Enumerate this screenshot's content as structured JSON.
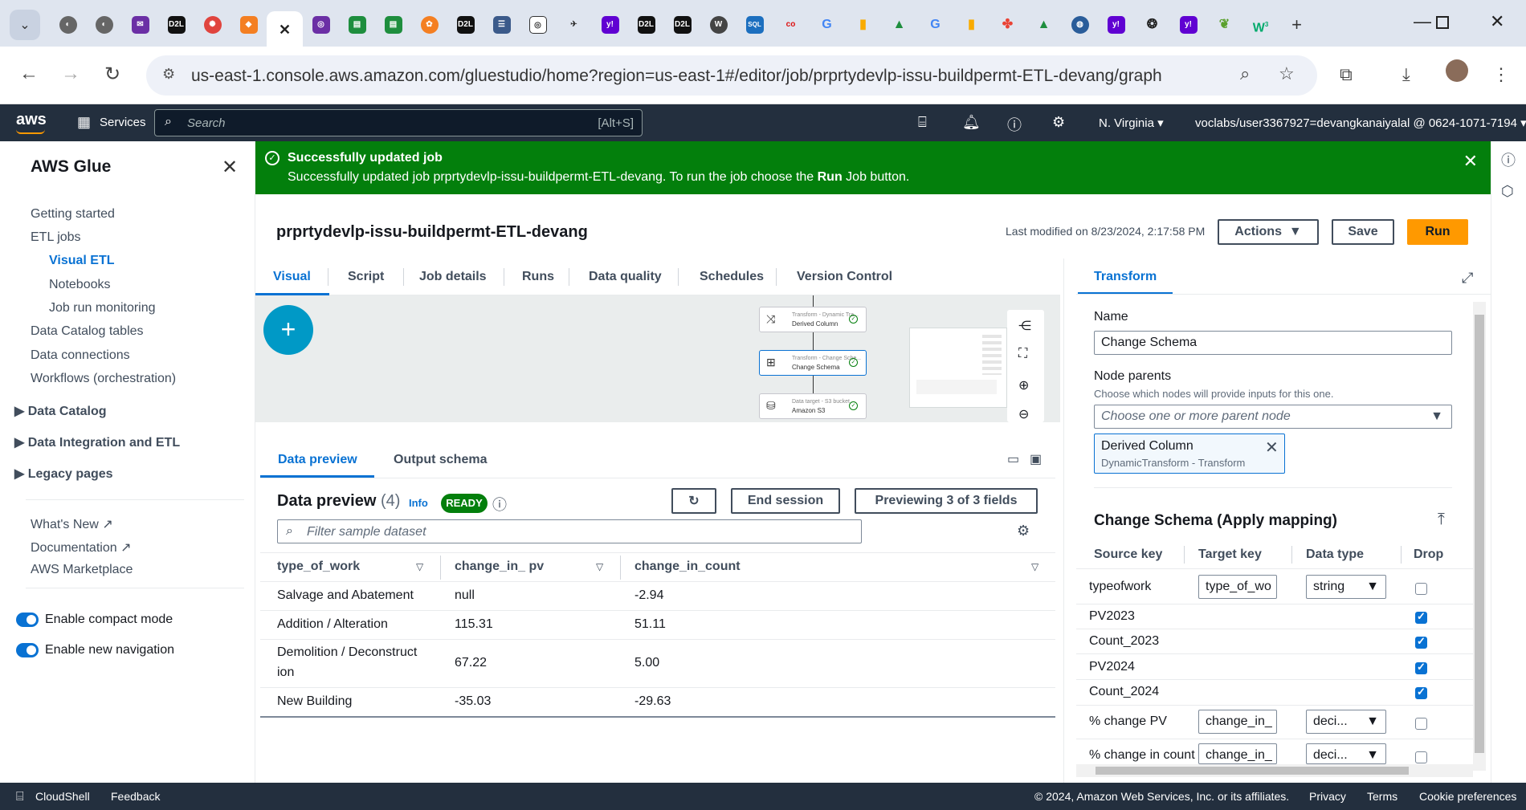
{
  "browser": {
    "url": "us-east-1.console.aws.amazon.com/gluestudio/home?region=us-east-1#/editor/job/prprtydevlp-issu-buildpermt-ETL-devang/graph",
    "tab_favicons": [
      "globe-icon",
      "globe-icon",
      "mail-icon",
      "d2l-icon",
      "wheel-icon",
      "cube-icon",
      "close-tab-icon",
      "search-tab-icon",
      "sheet-icon",
      "sheet-icon",
      "orange-icon",
      "d2l-icon",
      "doc-icon",
      "spiral-icon",
      "bird-icon",
      "yahoo-icon",
      "d2l-icon",
      "d2l-icon",
      "wordpress-icon",
      "sql-icon",
      "co-icon",
      "google-icon",
      "analytics-icon",
      "drive-icon",
      "google-icon",
      "analytics-icon",
      "pinwheel-icon",
      "drive-icon",
      "globe-icon",
      "yahoo-icon",
      "openai-icon",
      "yahoo-icon",
      "leaf-icon",
      "w3-icon"
    ],
    "d2l_text": "D2L",
    "sql_text": "SQL",
    "co_text": "co",
    "g_text": "G",
    "y_text": "y!",
    "w_text": "W",
    "w3_text": "3"
  },
  "awsnav": {
    "services": "Services",
    "search_placeholder": "Search",
    "search_shortcut": "[Alt+S]",
    "region": "N. Virginia",
    "account": "voclabs/user3367927=devangkanaiyalal @ 0624-1071-7194"
  },
  "sidebar": {
    "title": "AWS Glue",
    "getting_started": "Getting started",
    "etl_jobs": "ETL jobs",
    "visual_etl": "Visual ETL",
    "notebooks": "Notebooks",
    "job_run_monitoring": "Job run monitoring",
    "data_catalog_tables": "Data Catalog tables",
    "data_connections": "Data connections",
    "workflows": "Workflows (orchestration)",
    "sec_data_catalog": "Data Catalog",
    "sec_data_integration": "Data Integration and ETL",
    "sec_legacy": "Legacy pages",
    "whats_new": "What's New",
    "documentation": "Documentation",
    "marketplace": "AWS Marketplace",
    "compact_mode": "Enable compact mode",
    "new_navigation": "Enable new navigation"
  },
  "flash": {
    "title": "Successfully updated job",
    "message_pre": "Successfully updated job prprtydevlp-issu-buildpermt-ETL-devang. To run the job choose the ",
    "message_bold": "Run",
    "message_post": " Job button."
  },
  "job": {
    "name": "prprtydevlp-issu-buildpermt-ETL-devang",
    "last_modified": "Last modified on 8/23/2024, 2:17:58 PM",
    "actions": "Actions",
    "save": "Save",
    "run": "Run"
  },
  "tabs": [
    "Visual",
    "Script",
    "Job details",
    "Runs",
    "Data quality",
    "Schedules",
    "Version Control"
  ],
  "canvas": {
    "node1_type": "Transform - Dynamic Tra...",
    "node1_name": "Derived Column",
    "node2_type": "Transform - Change Sche...",
    "node2_name": "Change Schema",
    "node3_type": "Data target - S3 bucket",
    "node3_name": "Amazon S3",
    "add": "+"
  },
  "preview": {
    "tab_data_preview": "Data preview",
    "tab_output_schema": "Output schema",
    "title": "Data preview",
    "count": "(4)",
    "info": "Info",
    "status": "READY",
    "end_session": "End session",
    "previewing": "Previewing 3 of 3 fields",
    "filter_placeholder": "Filter sample dataset",
    "columns": [
      "type_of_work",
      "change_in_ pv",
      "change_in_count"
    ],
    "rows": [
      [
        "Salvage and Abatement",
        "null",
        "-2.94"
      ],
      [
        "Addition / Alteration",
        "115.31",
        "51.11"
      ],
      [
        "Demolition / Deconstruct",
        "67.22",
        "5.00"
      ],
      [
        "New Building",
        "-35.03",
        "-29.63"
      ]
    ],
    "row3_wrap": "ion"
  },
  "panel": {
    "tab": "Transform",
    "name_label": "Name",
    "name_value": "Change Schema",
    "parents_label": "Node parents",
    "parents_desc": "Choose which nodes will provide inputs for this one.",
    "parents_placeholder": "Choose one or more parent node",
    "chip_title": "Derived Column",
    "chip_sub": "DynamicTransform - Transform",
    "mapping_title": "Change Schema (Apply mapping)",
    "headers": [
      "Source key",
      "Target key",
      "Data type",
      "Drop"
    ],
    "rows": [
      {
        "source": "typeofwork",
        "target": "type_of_wo",
        "type": "string",
        "drop": false
      },
      {
        "source": "PV2023",
        "target": "",
        "type": "",
        "drop": true
      },
      {
        "source": "Count_2023",
        "target": "",
        "type": "",
        "drop": true
      },
      {
        "source": "PV2024",
        "target": "",
        "type": "",
        "drop": true
      },
      {
        "source": "Count_2024",
        "target": "",
        "type": "",
        "drop": true
      },
      {
        "source": "% change PV",
        "target": "change_in_",
        "type": "deci...",
        "drop": false
      },
      {
        "source": "% change in count",
        "target": "change_in_",
        "type": "deci...",
        "drop": false
      }
    ]
  },
  "footer": {
    "cloudshell": "CloudShell",
    "feedback": "Feedback",
    "copyright": "© 2024, Amazon Web Services, Inc. or its affiliates.",
    "privacy": "Privacy",
    "terms": "Terms",
    "cookies": "Cookie preferences"
  }
}
